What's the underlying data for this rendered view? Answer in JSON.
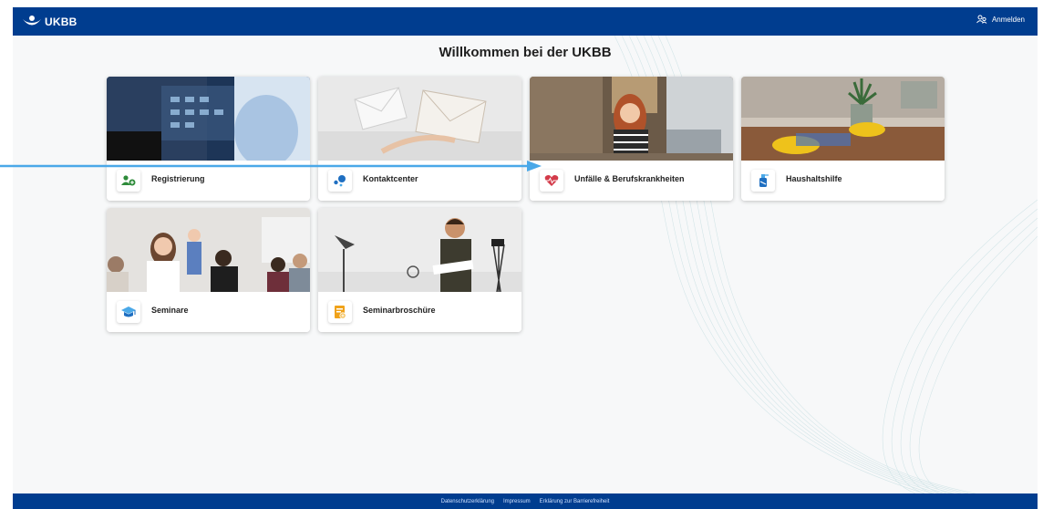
{
  "header": {
    "logo_text": "UKBB",
    "login_label": "Anmelden",
    "login_icon": "user-group-icon"
  },
  "main": {
    "title": "Willkommen bei der UKBB",
    "tiles": [
      {
        "label": "Registrierung",
        "icon": "add-user-icon"
      },
      {
        "label": "Kontaktcenter",
        "icon": "contact-dots-icon"
      },
      {
        "label": "Unfälle & Berufskrankheiten",
        "icon": "heart-pulse-icon"
      },
      {
        "label": "Haushaltshilfe",
        "icon": "cleaning-spray-icon"
      },
      {
        "label": "Seminare",
        "icon": "graduation-cap-icon"
      },
      {
        "label": "Seminarbroschüre",
        "icon": "brochure-icon"
      }
    ]
  },
  "footer": {
    "links": [
      "Datenschutzerklärung",
      "Impressum",
      "Erklärung zur Barrierefreiheit"
    ]
  },
  "colors": {
    "brand_blue": "#003d8f",
    "background": "#f7f8f9",
    "icon_green": "#2e8b3a",
    "icon_blue": "#1f6fc1",
    "icon_red": "#d33b4a",
    "icon_orange": "#f0a21a",
    "annotation_arrow": "#4aa8e8"
  }
}
